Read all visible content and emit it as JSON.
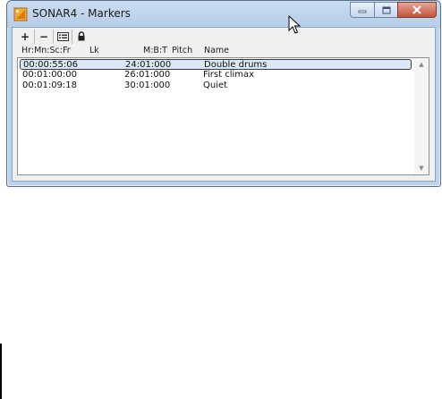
{
  "window": {
    "title": "SONAR4 - Markers",
    "app_icon": "sonar-app-icon",
    "controls": [
      "minimize-icon",
      "maximize-icon",
      "close-icon"
    ],
    "accent_color": "#c7513a"
  },
  "toolbar": {
    "add_label": "+",
    "remove_label": "−",
    "properties_icon": "properties-icon",
    "lock_icon": "lock-icon"
  },
  "columns": [
    "Hr:Mn:Sc:Fr",
    "Lk",
    "M:B:T",
    "Pitch",
    "Name"
  ],
  "markers": [
    {
      "time": "00:00:55:06",
      "lock": "",
      "mbt": "24:01:000",
      "pitch": "",
      "name": "Double drums",
      "selected": true
    },
    {
      "time": "00:01:00:00",
      "lock": "",
      "mbt": "26:01:000",
      "pitch": "",
      "name": "First climax",
      "selected": false
    },
    {
      "time": "00:01:09:18",
      "lock": "",
      "mbt": "30:01:000",
      "pitch": "",
      "name": "Quiet",
      "selected": false
    }
  ]
}
